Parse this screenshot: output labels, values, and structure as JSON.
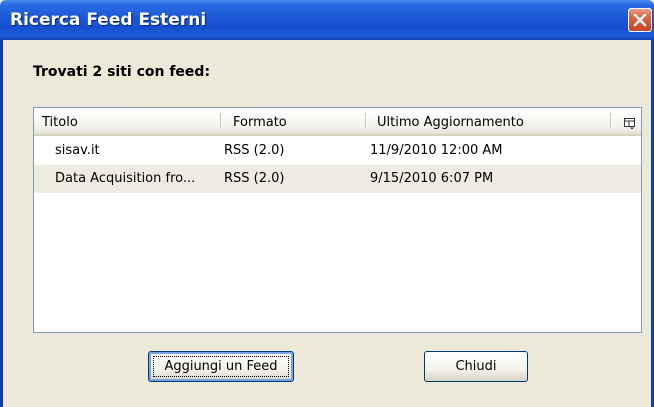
{
  "window": {
    "title": "Ricerca Feed Esterni",
    "close_icon": "close-icon"
  },
  "main": {
    "found_label": "Trovati 2 siti con feed:"
  },
  "list": {
    "columns": [
      "Titolo",
      "Formato",
      "Ultimo Aggiornamento"
    ],
    "column_picker_icon": "column-picker-icon",
    "rows": [
      {
        "title": "sisav.it",
        "format": "RSS (2.0)",
        "updated": "11/9/2010 12:00 AM"
      },
      {
        "title": "Data Acquisition fro...",
        "format": "RSS (2.0)",
        "updated": "9/15/2010 6:07 PM"
      }
    ]
  },
  "buttons": {
    "add": "Aggiungi un Feed",
    "close": "Chiudi"
  },
  "colors": {
    "titlebar": "#1650CF",
    "dialog_bg": "#ECE9D8",
    "alt_row": "#EEEBE1",
    "close_button": "#D9603F"
  }
}
